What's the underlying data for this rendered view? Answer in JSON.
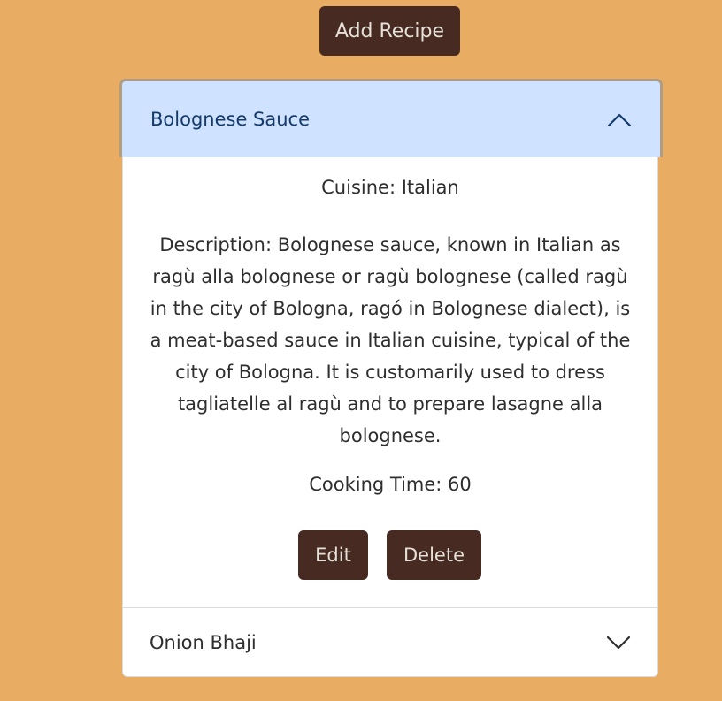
{
  "header": {
    "add_recipe_label": "Add Recipe"
  },
  "recipes": [
    {
      "title": "Bolognese Sauce",
      "expanded": true,
      "cuisine": "Cuisine: Italian",
      "description": "Description: Bolognese sauce, known in Italian as ragù alla bolognese or ragù bolognese (called ragù in the city of Bologna, ragó in Bolognese dialect), is a meat-based sauce in Italian cuisine, typical of the city of Bologna. It is customarily used to dress tagliatelle al ragù and to prepare lasagne alla bolognese.",
      "cooking_time": "Cooking Time: 60",
      "edit_label": "Edit",
      "delete_label": "Delete"
    },
    {
      "title": "Onion Bhaji",
      "expanded": false
    }
  ],
  "icons": {
    "expanded": "chevron-up-icon",
    "collapsed": "chevron-down-icon"
  },
  "colors": {
    "background": "#e8ad63",
    "button": "#472a21",
    "button_text": "#e5e0d8",
    "active_header": "#cfe2ff",
    "active_header_text": "#143a6b"
  }
}
